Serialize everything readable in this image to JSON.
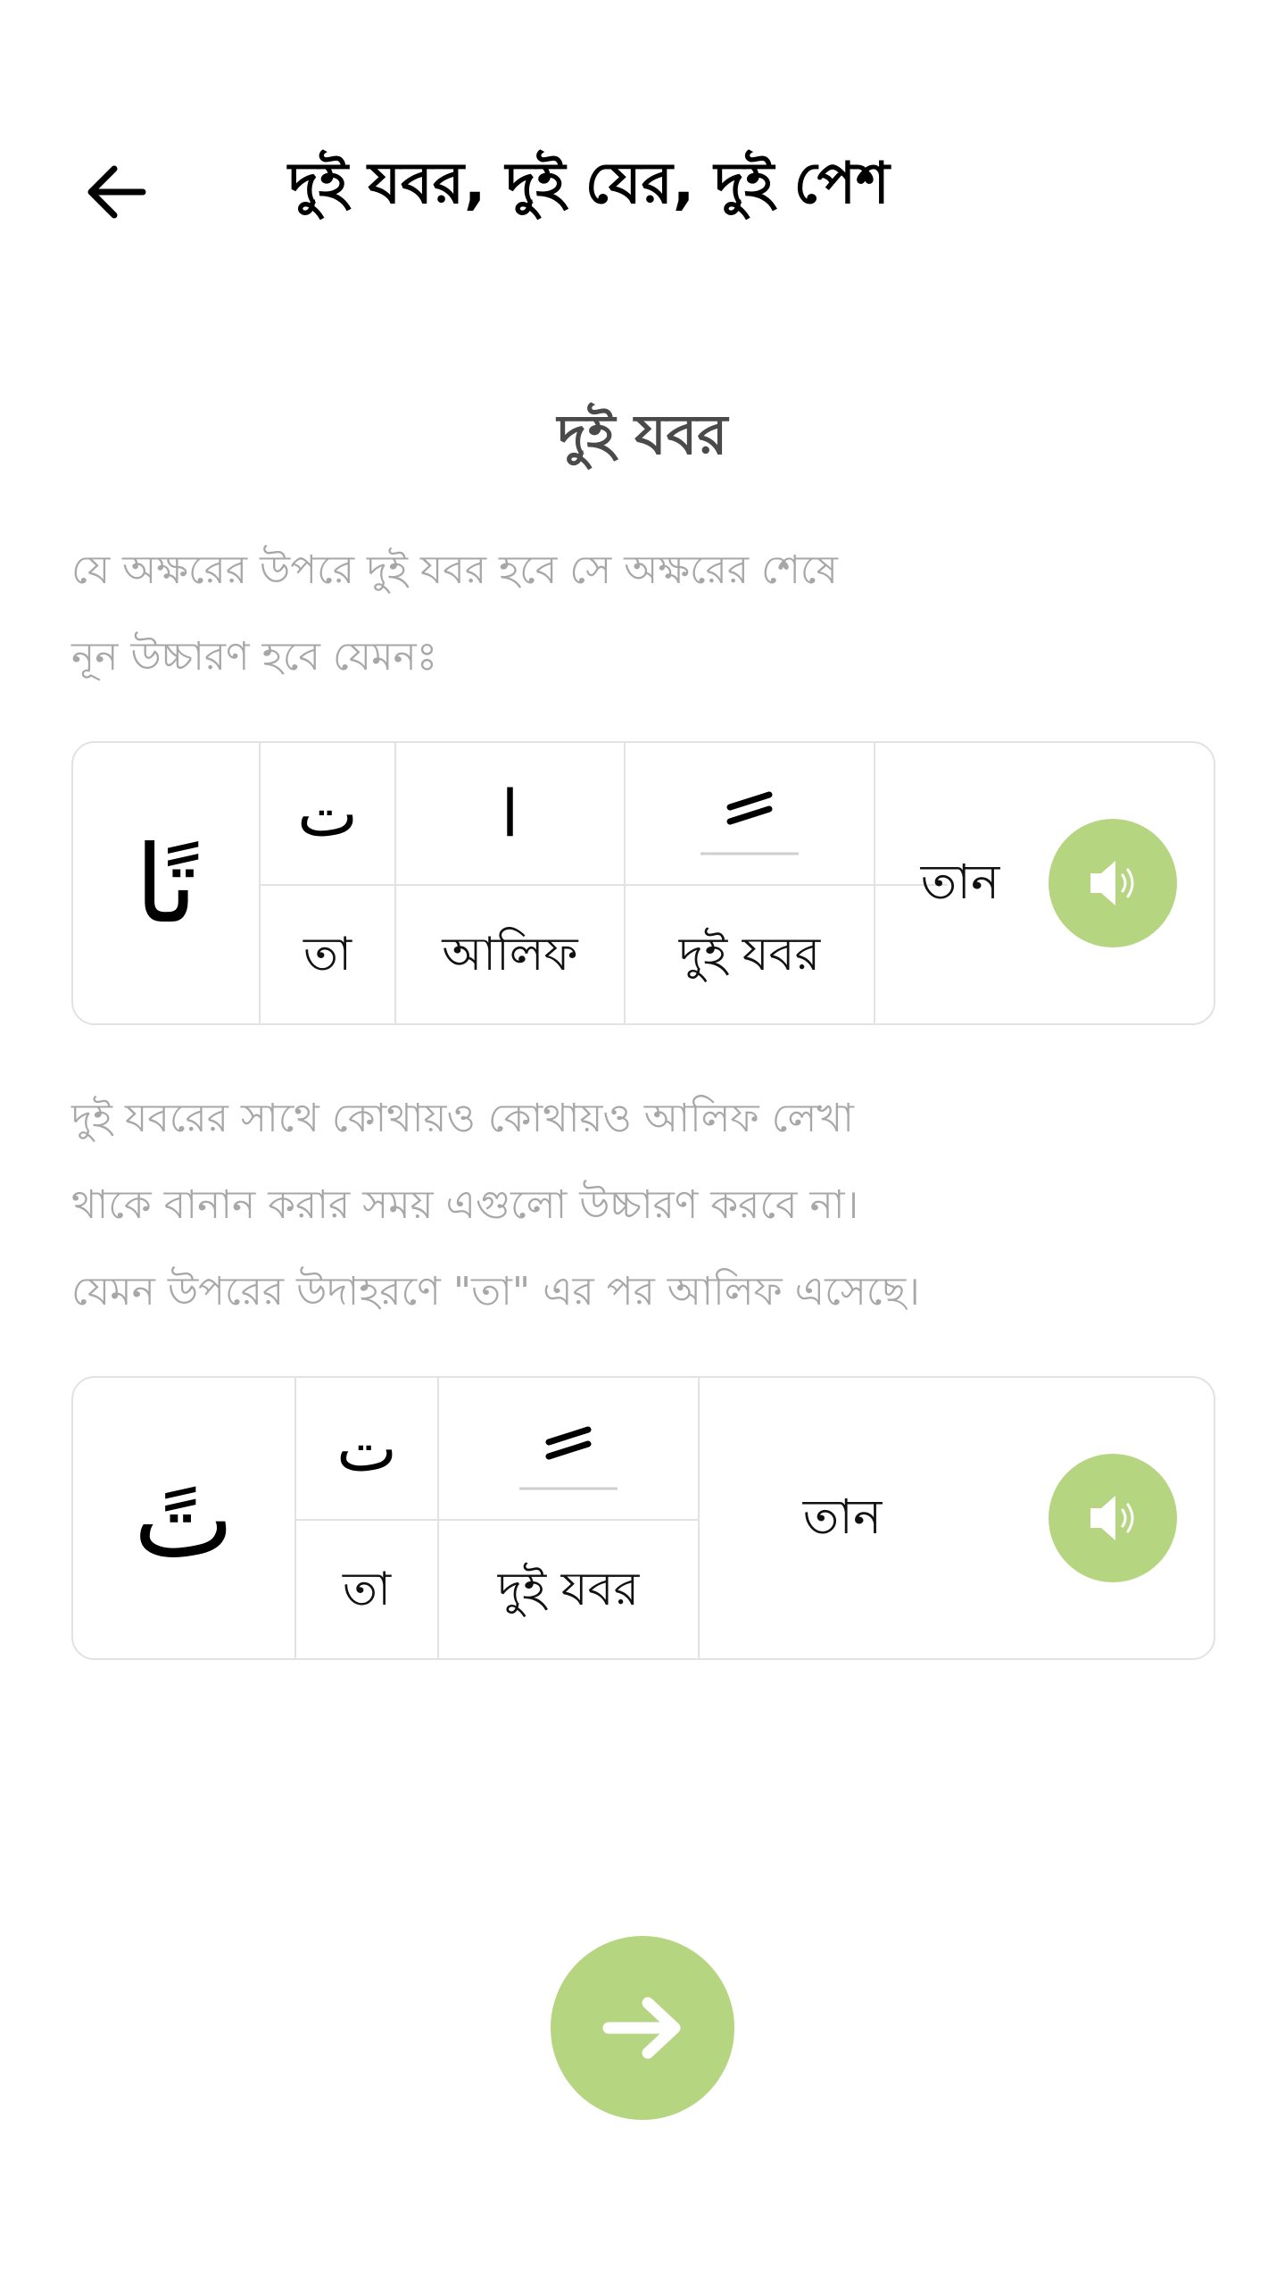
{
  "header": {
    "title": "দুই যবর, দুই যের, দুই পেশ"
  },
  "section": {
    "title": "দুই যবর"
  },
  "intro": {
    "line1": "যে অক্ষরের উপরে দুই যবর হবে সে অক্ষরের শেষে",
    "line2": "নূন উচ্চারণ হবে যেমনঃ"
  },
  "card1": {
    "word": "تًا",
    "letter1": "ت",
    "letter1_name": "তা",
    "letter2": "ا",
    "letter2_name": "আলিফ",
    "mark_name": "দুই যবর",
    "result": "তান"
  },
  "note": {
    "line1": "দুই যবরের সাথে কোথায়ও কোথায়ও আলিফ লেখা",
    "line2": "থাকে বানান করার সময় এগুলো উচ্চারণ করবে না।",
    "line3": "যেমন উপরের উদাহরণে \"তা\" এর পর আলিফ এসেছে।"
  },
  "card2": {
    "word": "تً",
    "letter1": "ت",
    "letter1_name": "তা",
    "mark_name": "দুই যবর",
    "result": "তান"
  },
  "colors": {
    "accent": "#b5d581",
    "border": "#e2e2e2",
    "muted_text": "#a7a7a7",
    "section_title": "#4a4a4a"
  },
  "icons": {
    "back": "arrow-left-icon",
    "speaker": "speaker-icon",
    "next": "arrow-right-icon"
  }
}
